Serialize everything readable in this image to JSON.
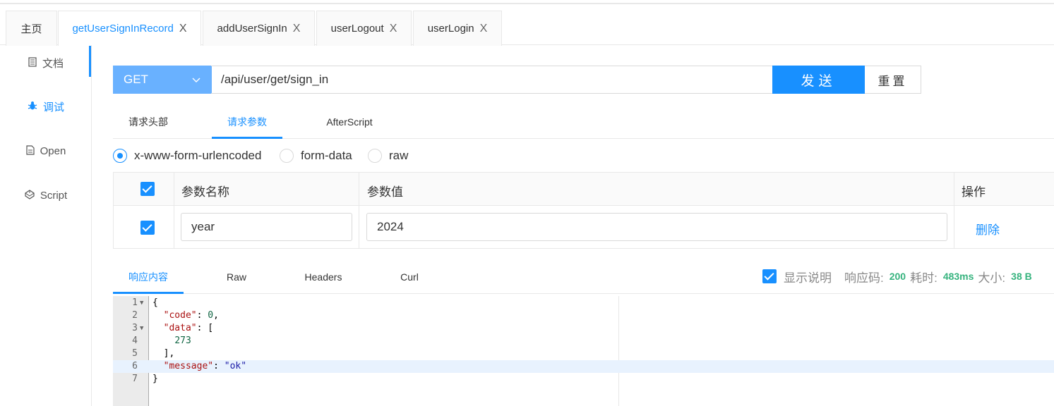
{
  "tabs": [
    {
      "label": "主页",
      "closable": false,
      "active": false
    },
    {
      "label": "getUserSignInRecord",
      "closable": true,
      "active": true
    },
    {
      "label": "addUserSignIn",
      "closable": true,
      "active": false
    },
    {
      "label": "userLogout",
      "closable": true,
      "active": false
    },
    {
      "label": "userLogin",
      "closable": true,
      "active": false
    }
  ],
  "close_glyph": "X",
  "sidebar": {
    "items": [
      {
        "label": "文档",
        "icon": "document-icon",
        "active": false
      },
      {
        "label": "调试",
        "icon": "bug-icon",
        "active": true
      },
      {
        "label": "Open",
        "icon": "file-icon",
        "active": false
      },
      {
        "label": "Script",
        "icon": "codepen-icon",
        "active": false
      }
    ]
  },
  "request": {
    "method": "GET",
    "url": "/api/user/get/sign_in",
    "send_label": "发送",
    "reset_label": "重置"
  },
  "request_tabs": [
    {
      "label": "请求头部",
      "active": false
    },
    {
      "label": "请求参数",
      "active": true
    },
    {
      "label": "AfterScript",
      "active": false
    }
  ],
  "body_types": [
    {
      "label": "x-www-form-urlencoded",
      "checked": true
    },
    {
      "label": "form-data",
      "checked": false
    },
    {
      "label": "raw",
      "checked": false
    }
  ],
  "params_table": {
    "headers": [
      "参数名称",
      "参数值",
      "操作"
    ],
    "rows": [
      {
        "checked": true,
        "name": "year",
        "value": "2024",
        "action": "删除"
      }
    ]
  },
  "response_tabs": [
    {
      "label": "响应内容",
      "active": true
    },
    {
      "label": "Raw",
      "active": false
    },
    {
      "label": "Headers",
      "active": false
    },
    {
      "label": "Curl",
      "active": false
    }
  ],
  "response_info": {
    "show_desc_label": "显示说明",
    "status_label": "响应码:",
    "status_value": "200",
    "time_label": "耗时:",
    "time_value": "483ms",
    "size_label": "大小:",
    "size_value": "38 B"
  },
  "response_body": {
    "lines": [
      "1",
      "2",
      "3",
      "4",
      "5",
      "6",
      "7"
    ],
    "code_key": "\"code\"",
    "code_val": "0",
    "data_key": "\"data\"",
    "data_item": "273",
    "message_key": "\"message\"",
    "message_val": "\"ok\"",
    "highlighted_line": 6
  },
  "colors": {
    "accent": "#1890ff",
    "method_bg": "#69b1ff",
    "success": "#36b37e"
  }
}
